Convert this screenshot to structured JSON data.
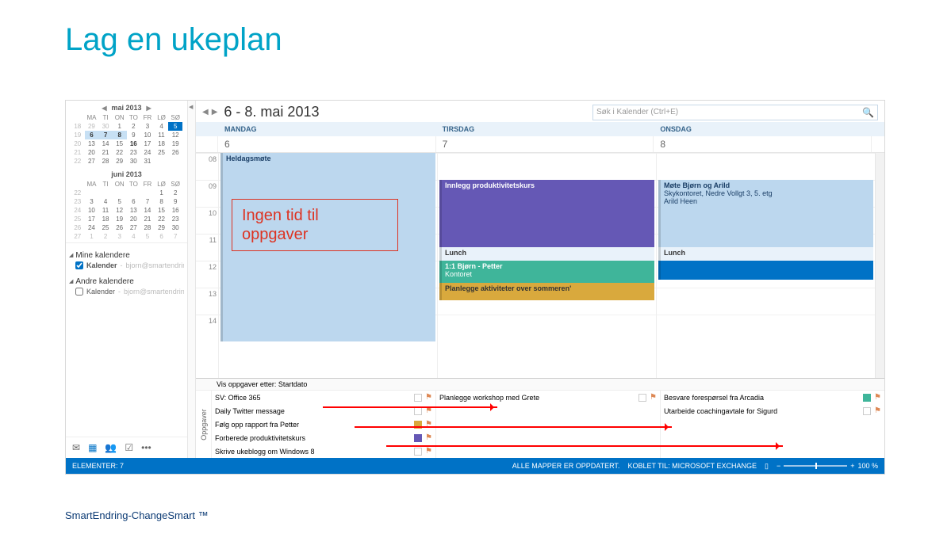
{
  "slide": {
    "title": "Lag en ukeplan",
    "footer": "SmartEndring-ChangeSmart ™"
  },
  "minical1": {
    "title": "mai 2013",
    "dow": [
      "MA",
      "TI",
      "ON",
      "TO",
      "FR",
      "LØ",
      "SØ"
    ],
    "weeks": [
      {
        "wk": "18",
        "days": [
          {
            "n": 29,
            "dim": true
          },
          {
            "n": 30,
            "dim": true
          },
          {
            "n": 1
          },
          {
            "n": 2
          },
          {
            "n": 3
          },
          {
            "n": 4
          },
          {
            "n": 5,
            "today": true
          }
        ]
      },
      {
        "wk": "19",
        "days": [
          {
            "n": 6,
            "range": true,
            "bold": true
          },
          {
            "n": 7,
            "range": true,
            "bold": true
          },
          {
            "n": 8,
            "range": true,
            "bold": true
          },
          {
            "n": 9
          },
          {
            "n": 10
          },
          {
            "n": 11
          },
          {
            "n": 12
          }
        ]
      },
      {
        "wk": "20",
        "days": [
          {
            "n": 13
          },
          {
            "n": 14
          },
          {
            "n": 15
          },
          {
            "n": 16,
            "bold": true
          },
          {
            "n": 17
          },
          {
            "n": 18
          },
          {
            "n": 19
          }
        ]
      },
      {
        "wk": "21",
        "days": [
          {
            "n": 20
          },
          {
            "n": 21
          },
          {
            "n": 22
          },
          {
            "n": 23
          },
          {
            "n": 24
          },
          {
            "n": 25
          },
          {
            "n": 26
          }
        ]
      },
      {
        "wk": "22",
        "days": [
          {
            "n": 27
          },
          {
            "n": 28
          },
          {
            "n": 29
          },
          {
            "n": 30
          },
          {
            "n": 31
          },
          {
            "n": "",
            "dim": true
          },
          {
            "n": "",
            "dim": true
          }
        ]
      }
    ]
  },
  "minical2": {
    "title": "juni 2013",
    "dow": [
      "MA",
      "TI",
      "ON",
      "TO",
      "FR",
      "LØ",
      "SØ"
    ],
    "weeks": [
      {
        "wk": "22",
        "days": [
          {
            "n": "",
            "dim": true
          },
          {
            "n": "",
            "dim": true
          },
          {
            "n": "",
            "dim": true
          },
          {
            "n": "",
            "dim": true
          },
          {
            "n": "",
            "dim": true
          },
          {
            "n": 1
          },
          {
            "n": 2
          }
        ]
      },
      {
        "wk": "23",
        "days": [
          {
            "n": 3
          },
          {
            "n": 4
          },
          {
            "n": 5
          },
          {
            "n": 6
          },
          {
            "n": 7
          },
          {
            "n": 8
          },
          {
            "n": 9
          }
        ]
      },
      {
        "wk": "24",
        "days": [
          {
            "n": 10
          },
          {
            "n": 11
          },
          {
            "n": 12
          },
          {
            "n": 13
          },
          {
            "n": 14
          },
          {
            "n": 15
          },
          {
            "n": 16
          }
        ]
      },
      {
        "wk": "25",
        "days": [
          {
            "n": 17
          },
          {
            "n": 18
          },
          {
            "n": 19
          },
          {
            "n": 20
          },
          {
            "n": 21
          },
          {
            "n": 22
          },
          {
            "n": 23
          }
        ]
      },
      {
        "wk": "26",
        "days": [
          {
            "n": 24
          },
          {
            "n": 25
          },
          {
            "n": 26
          },
          {
            "n": 27
          },
          {
            "n": 28
          },
          {
            "n": 29
          },
          {
            "n": 30
          }
        ]
      },
      {
        "wk": "27",
        "days": [
          {
            "n": 1,
            "dim": true
          },
          {
            "n": 2,
            "dim": true
          },
          {
            "n": 3,
            "dim": true
          },
          {
            "n": 4,
            "dim": true
          },
          {
            "n": 5,
            "dim": true
          },
          {
            "n": 6,
            "dim": true
          },
          {
            "n": 7,
            "dim": true
          }
        ]
      }
    ]
  },
  "calendars": {
    "mine": {
      "label": "Mine kalendere",
      "item": {
        "checked": true,
        "name": "Kalender",
        "owner": "bjorn@smartendring.no"
      }
    },
    "andre": {
      "label": "Andre kalendere",
      "item": {
        "checked": false,
        "name": "Kalender",
        "owner": "bjorn@smartendring.no"
      }
    }
  },
  "header": {
    "date_range": "6 - 8. mai 2013",
    "search_placeholder": "Søk i Kalender (Ctrl+E)"
  },
  "days": {
    "headers": [
      "MANDAG",
      "TIRSDAG",
      "ONSDAG"
    ],
    "dates": [
      "6",
      "7",
      "8"
    ]
  },
  "hours": [
    "08",
    "09",
    "10",
    "11",
    "12",
    "13",
    "14"
  ],
  "events": {
    "mon_allday": "Heldagsmøte",
    "tue_innlegg": "Innlegg produktivitetskurs",
    "tue_lunch": "Lunch",
    "tue_11": {
      "title": "1:1 Bjørn - Petter",
      "loc": "Kontoret"
    },
    "tue_plan": "Planlegge aktiviteter over sommeren'",
    "wed_mote": {
      "title": "Møte Bjørn og Arild",
      "loc": "Skykontoret, Nedre Vollgt 3, 5. etg",
      "extra": "Arild Heen"
    },
    "wed_lunch": "Lunch"
  },
  "annotation": "Ingen tid til oppgaver",
  "tasks": {
    "header": "Vis oppgaver etter: Startdato",
    "label": "Oppgaver",
    "col1": [
      "SV: Office 365",
      "Daily Twitter message",
      "Følg opp rapport fra Petter",
      "Forberede produktivitetskurs",
      "Skrive ukeblogg om Windows 8"
    ],
    "col2": [
      "Planlegge workshop med Grete"
    ],
    "col3": [
      "Besvare forespørsel fra Arcadia",
      "Utarbeide coachingavtale for Sigurd"
    ]
  },
  "status": {
    "items": "ELEMENTER: 7",
    "folders": "ALLE MAPPER ER OPPDATERT.",
    "connected": "KOBLET TIL: MICROSOFT EXCHANGE",
    "zoom": "100 %"
  }
}
